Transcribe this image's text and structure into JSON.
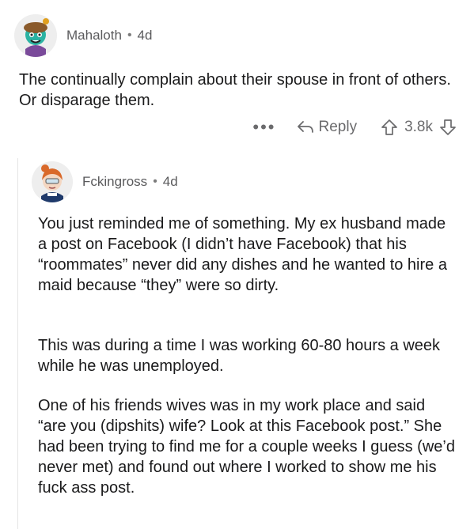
{
  "comment1": {
    "username": "Mahaloth",
    "separator": "•",
    "age": "4d",
    "text": "The continually complain about their spouse in front of others. Or disparage them.",
    "actions": {
      "more_label": "•••",
      "reply_label": "Reply",
      "vote_count": "3.8k"
    }
  },
  "comment2": {
    "username": "Fckingross",
    "separator": "•",
    "age": "4d",
    "paragraphs": [
      "You just reminded me of something. My ex husband made a post on Facebook (I didn’t have Facebook) that his “roommates” never did any dishes and he wanted to hire a maid because “they” were so dirty.",
      "This was during a time I was working 60-80 hours a week while he was unemployed.",
      "One of his friends wives was in my work place and said “are you (dipshits) wife? Look at this Facebook post.” She had been trying to find me for a couple weeks I guess (we’d never met) and found out where I worked to show me his fuck ass post."
    ]
  },
  "icons": {
    "more": "more-dots-icon",
    "reply": "reply-arrow-icon",
    "upvote": "upvote-arrow-icon",
    "downvote": "downvote-arrow-icon"
  }
}
